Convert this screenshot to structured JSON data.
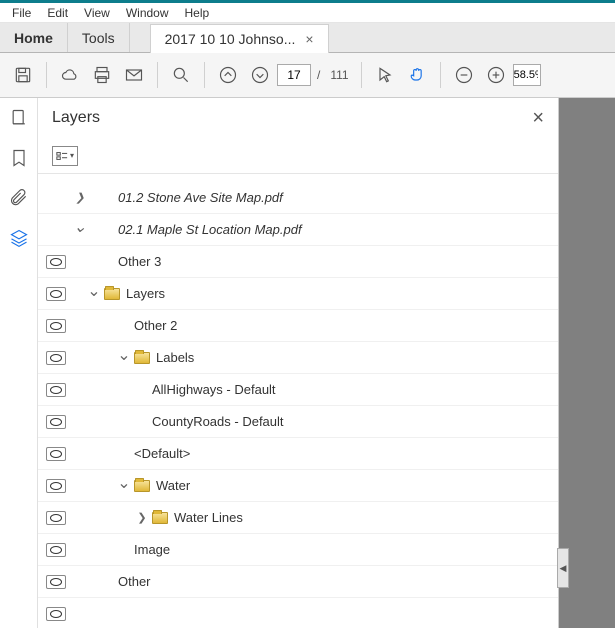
{
  "menubar": [
    "File",
    "Edit",
    "View",
    "Window",
    "Help"
  ],
  "tabs": {
    "home": "Home",
    "tools": "Tools",
    "doc": "2017 10 10 Johnso..."
  },
  "page": {
    "current": "17",
    "total": "111"
  },
  "zoom": "58.5%",
  "panel": {
    "title": "Layers"
  },
  "tree": {
    "r0": "01.2 Stone Ave Site Map.pdf",
    "r1": "02.1 Maple St Location Map.pdf",
    "r2": "Other 3",
    "r3": "Layers",
    "r4": "Other 2",
    "r5": "Labels",
    "r6": "AllHighways - Default",
    "r7": "CountyRoads - Default",
    "r8": "<Default>",
    "r9": "Water",
    "r10": "Water Lines",
    "r11": "Image",
    "r12": "Other"
  }
}
